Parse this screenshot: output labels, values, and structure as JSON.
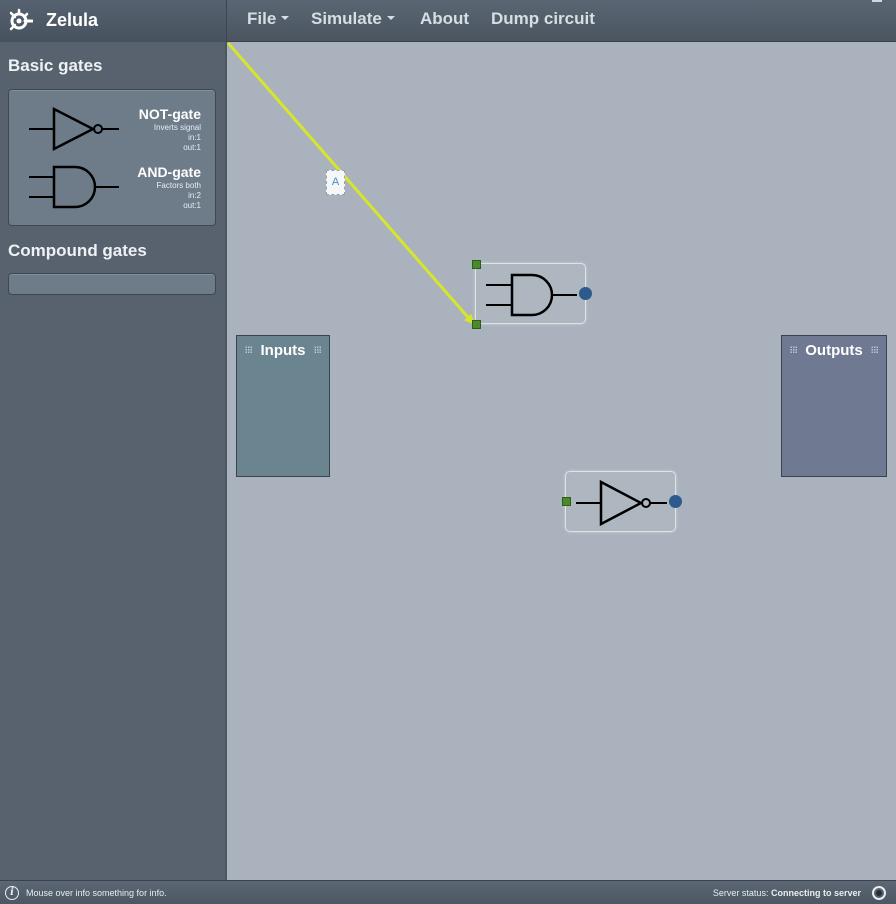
{
  "app": {
    "title": "Zelula"
  },
  "menu": {
    "file": "File",
    "simulate": "Simulate",
    "about": "About",
    "dump": "Dump circuit"
  },
  "sidebar": {
    "basic_title": "Basic gates",
    "compound_title": "Compound gates",
    "gates": [
      {
        "name": "NOT-gate",
        "desc": "Inverts signal",
        "in": "in:1",
        "out": "out:1",
        "icon": "not-gate-icon"
      },
      {
        "name": "AND-gate",
        "desc": "Factors both",
        "in": "in:2",
        "out": "out:1",
        "icon": "and-gate-icon"
      }
    ]
  },
  "canvas": {
    "inputs_title": "Inputs",
    "outputs_title": "Outputs",
    "wire_label": "A",
    "colors": {
      "wire": "#d8e62a",
      "input_pin": "#4a8a2a",
      "output_pin": "#2c5a8c",
      "inputs_box": "#6a8590",
      "outputs_box": "#6f7992"
    }
  },
  "status": {
    "info": "Mouse over info something for info.",
    "server_label": "Server status:",
    "server_value": "Connecting to server"
  }
}
